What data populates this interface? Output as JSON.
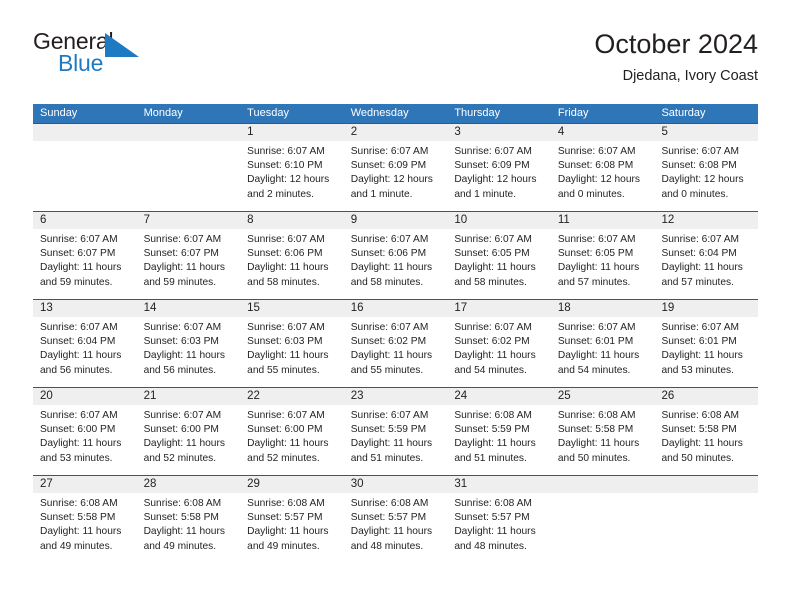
{
  "brand": {
    "name_part1": "General",
    "name_part2": "Blue",
    "flag_icon": "blue-triangle-flag-icon",
    "accent_color": "#1f7ac4"
  },
  "header": {
    "title": "October 2024",
    "subtitle": "Djedana, Ivory Coast"
  },
  "calendar": {
    "header_color": "#2e76b8",
    "rule_color": "#1f5c99",
    "day_band_color": "#efefef",
    "weekdays": [
      "Sunday",
      "Monday",
      "Tuesday",
      "Wednesday",
      "Thursday",
      "Friday",
      "Saturday"
    ],
    "weeks": [
      [
        {
          "day": "",
          "sunrise": "",
          "sunset": "",
          "daylight_line1": "",
          "daylight_line2": ""
        },
        {
          "day": "",
          "sunrise": "",
          "sunset": "",
          "daylight_line1": "",
          "daylight_line2": ""
        },
        {
          "day": "1",
          "sunrise": "Sunrise: 6:07 AM",
          "sunset": "Sunset: 6:10 PM",
          "daylight_line1": "Daylight: 12 hours",
          "daylight_line2": "and 2 minutes."
        },
        {
          "day": "2",
          "sunrise": "Sunrise: 6:07 AM",
          "sunset": "Sunset: 6:09 PM",
          "daylight_line1": "Daylight: 12 hours",
          "daylight_line2": "and 1 minute."
        },
        {
          "day": "3",
          "sunrise": "Sunrise: 6:07 AM",
          "sunset": "Sunset: 6:09 PM",
          "daylight_line1": "Daylight: 12 hours",
          "daylight_line2": "and 1 minute."
        },
        {
          "day": "4",
          "sunrise": "Sunrise: 6:07 AM",
          "sunset": "Sunset: 6:08 PM",
          "daylight_line1": "Daylight: 12 hours",
          "daylight_line2": "and 0 minutes."
        },
        {
          "day": "5",
          "sunrise": "Sunrise: 6:07 AM",
          "sunset": "Sunset: 6:08 PM",
          "daylight_line1": "Daylight: 12 hours",
          "daylight_line2": "and 0 minutes."
        }
      ],
      [
        {
          "day": "6",
          "sunrise": "Sunrise: 6:07 AM",
          "sunset": "Sunset: 6:07 PM",
          "daylight_line1": "Daylight: 11 hours",
          "daylight_line2": "and 59 minutes."
        },
        {
          "day": "7",
          "sunrise": "Sunrise: 6:07 AM",
          "sunset": "Sunset: 6:07 PM",
          "daylight_line1": "Daylight: 11 hours",
          "daylight_line2": "and 59 minutes."
        },
        {
          "day": "8",
          "sunrise": "Sunrise: 6:07 AM",
          "sunset": "Sunset: 6:06 PM",
          "daylight_line1": "Daylight: 11 hours",
          "daylight_line2": "and 58 minutes."
        },
        {
          "day": "9",
          "sunrise": "Sunrise: 6:07 AM",
          "sunset": "Sunset: 6:06 PM",
          "daylight_line1": "Daylight: 11 hours",
          "daylight_line2": "and 58 minutes."
        },
        {
          "day": "10",
          "sunrise": "Sunrise: 6:07 AM",
          "sunset": "Sunset: 6:05 PM",
          "daylight_line1": "Daylight: 11 hours",
          "daylight_line2": "and 58 minutes."
        },
        {
          "day": "11",
          "sunrise": "Sunrise: 6:07 AM",
          "sunset": "Sunset: 6:05 PM",
          "daylight_line1": "Daylight: 11 hours",
          "daylight_line2": "and 57 minutes."
        },
        {
          "day": "12",
          "sunrise": "Sunrise: 6:07 AM",
          "sunset": "Sunset: 6:04 PM",
          "daylight_line1": "Daylight: 11 hours",
          "daylight_line2": "and 57 minutes."
        }
      ],
      [
        {
          "day": "13",
          "sunrise": "Sunrise: 6:07 AM",
          "sunset": "Sunset: 6:04 PM",
          "daylight_line1": "Daylight: 11 hours",
          "daylight_line2": "and 56 minutes."
        },
        {
          "day": "14",
          "sunrise": "Sunrise: 6:07 AM",
          "sunset": "Sunset: 6:03 PM",
          "daylight_line1": "Daylight: 11 hours",
          "daylight_line2": "and 56 minutes."
        },
        {
          "day": "15",
          "sunrise": "Sunrise: 6:07 AM",
          "sunset": "Sunset: 6:03 PM",
          "daylight_line1": "Daylight: 11 hours",
          "daylight_line2": "and 55 minutes."
        },
        {
          "day": "16",
          "sunrise": "Sunrise: 6:07 AM",
          "sunset": "Sunset: 6:02 PM",
          "daylight_line1": "Daylight: 11 hours",
          "daylight_line2": "and 55 minutes."
        },
        {
          "day": "17",
          "sunrise": "Sunrise: 6:07 AM",
          "sunset": "Sunset: 6:02 PM",
          "daylight_line1": "Daylight: 11 hours",
          "daylight_line2": "and 54 minutes."
        },
        {
          "day": "18",
          "sunrise": "Sunrise: 6:07 AM",
          "sunset": "Sunset: 6:01 PM",
          "daylight_line1": "Daylight: 11 hours",
          "daylight_line2": "and 54 minutes."
        },
        {
          "day": "19",
          "sunrise": "Sunrise: 6:07 AM",
          "sunset": "Sunset: 6:01 PM",
          "daylight_line1": "Daylight: 11 hours",
          "daylight_line2": "and 53 minutes."
        }
      ],
      [
        {
          "day": "20",
          "sunrise": "Sunrise: 6:07 AM",
          "sunset": "Sunset: 6:00 PM",
          "daylight_line1": "Daylight: 11 hours",
          "daylight_line2": "and 53 minutes."
        },
        {
          "day": "21",
          "sunrise": "Sunrise: 6:07 AM",
          "sunset": "Sunset: 6:00 PM",
          "daylight_line1": "Daylight: 11 hours",
          "daylight_line2": "and 52 minutes."
        },
        {
          "day": "22",
          "sunrise": "Sunrise: 6:07 AM",
          "sunset": "Sunset: 6:00 PM",
          "daylight_line1": "Daylight: 11 hours",
          "daylight_line2": "and 52 minutes."
        },
        {
          "day": "23",
          "sunrise": "Sunrise: 6:07 AM",
          "sunset": "Sunset: 5:59 PM",
          "daylight_line1": "Daylight: 11 hours",
          "daylight_line2": "and 51 minutes."
        },
        {
          "day": "24",
          "sunrise": "Sunrise: 6:08 AM",
          "sunset": "Sunset: 5:59 PM",
          "daylight_line1": "Daylight: 11 hours",
          "daylight_line2": "and 51 minutes."
        },
        {
          "day": "25",
          "sunrise": "Sunrise: 6:08 AM",
          "sunset": "Sunset: 5:58 PM",
          "daylight_line1": "Daylight: 11 hours",
          "daylight_line2": "and 50 minutes."
        },
        {
          "day": "26",
          "sunrise": "Sunrise: 6:08 AM",
          "sunset": "Sunset: 5:58 PM",
          "daylight_line1": "Daylight: 11 hours",
          "daylight_line2": "and 50 minutes."
        }
      ],
      [
        {
          "day": "27",
          "sunrise": "Sunrise: 6:08 AM",
          "sunset": "Sunset: 5:58 PM",
          "daylight_line1": "Daylight: 11 hours",
          "daylight_line2": "and 49 minutes."
        },
        {
          "day": "28",
          "sunrise": "Sunrise: 6:08 AM",
          "sunset": "Sunset: 5:58 PM",
          "daylight_line1": "Daylight: 11 hours",
          "daylight_line2": "and 49 minutes."
        },
        {
          "day": "29",
          "sunrise": "Sunrise: 6:08 AM",
          "sunset": "Sunset: 5:57 PM",
          "daylight_line1": "Daylight: 11 hours",
          "daylight_line2": "and 49 minutes."
        },
        {
          "day": "30",
          "sunrise": "Sunrise: 6:08 AM",
          "sunset": "Sunset: 5:57 PM",
          "daylight_line1": "Daylight: 11 hours",
          "daylight_line2": "and 48 minutes."
        },
        {
          "day": "31",
          "sunrise": "Sunrise: 6:08 AM",
          "sunset": "Sunset: 5:57 PM",
          "daylight_line1": "Daylight: 11 hours",
          "daylight_line2": "and 48 minutes."
        },
        {
          "day": "",
          "sunrise": "",
          "sunset": "",
          "daylight_line1": "",
          "daylight_line2": ""
        },
        {
          "day": "",
          "sunrise": "",
          "sunset": "",
          "daylight_line1": "",
          "daylight_line2": ""
        }
      ]
    ]
  }
}
